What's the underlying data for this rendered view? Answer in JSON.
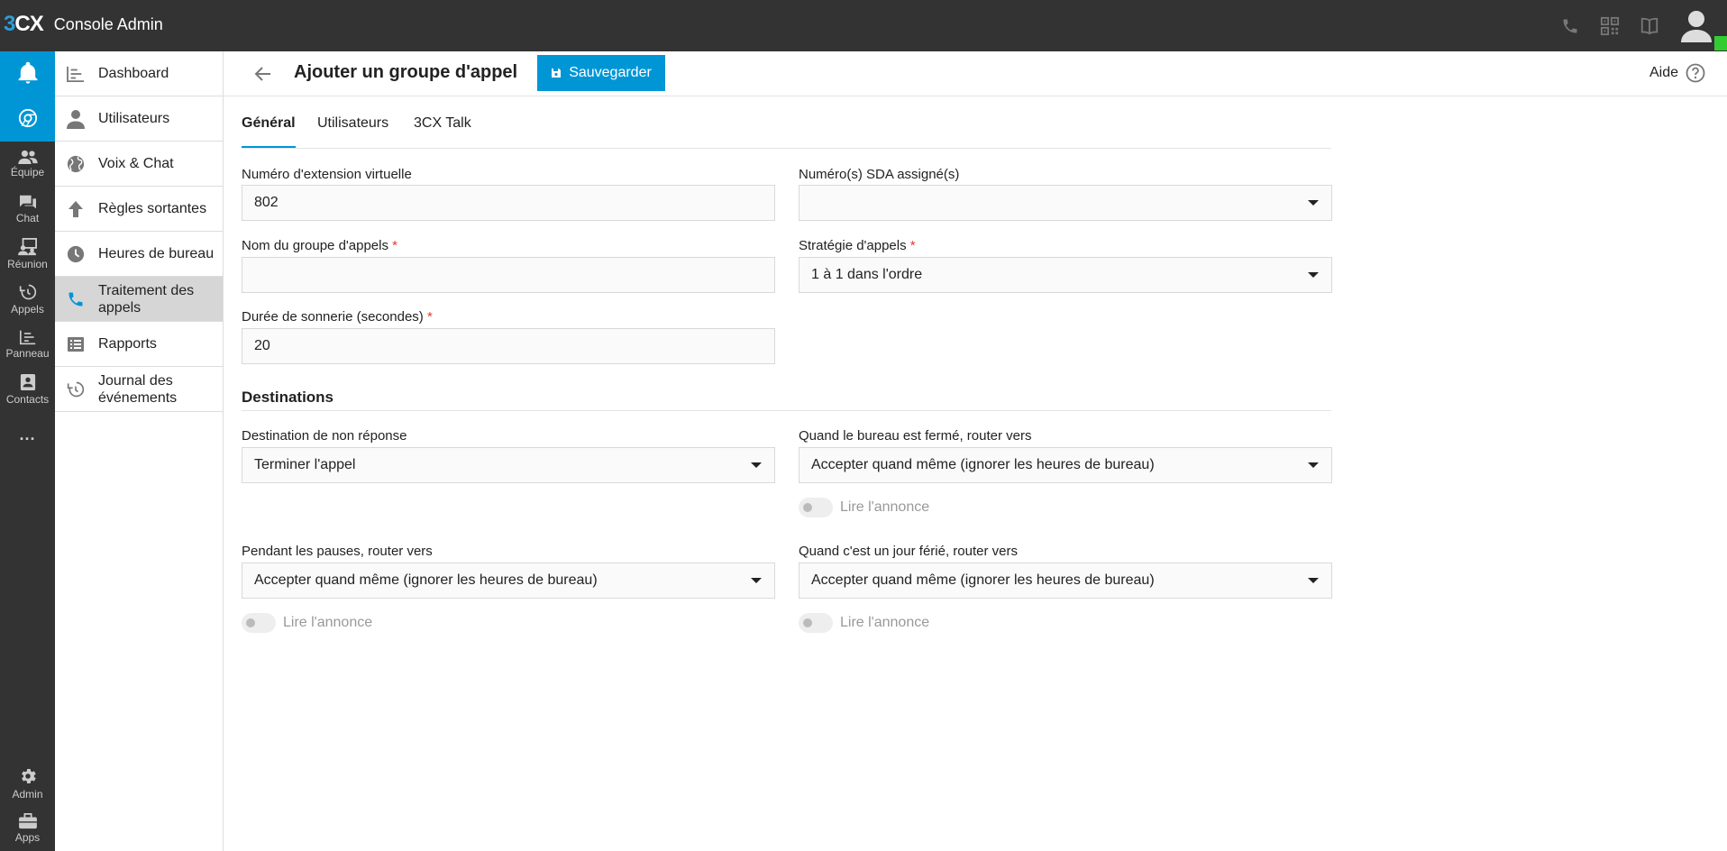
{
  "app": {
    "logo_three": "3",
    "logo_cx": "CX",
    "title": "Console Admin"
  },
  "topbar_icons": [
    "phone-icon",
    "qr-code-icon",
    "book-icon",
    "user-avatar-icon"
  ],
  "rail": {
    "items": [
      {
        "icon": "bell-icon",
        "label": ""
      },
      {
        "icon": "chrome-icon",
        "label": ""
      },
      {
        "icon": "team-icon",
        "label": "Équipe"
      },
      {
        "icon": "chat-icon",
        "label": "Chat"
      },
      {
        "icon": "meeting-icon",
        "label": "Réunion"
      },
      {
        "icon": "history-icon",
        "label": "Appels"
      },
      {
        "icon": "panel-icon",
        "label": "Panneau"
      },
      {
        "icon": "contacts-icon",
        "label": "Contacts"
      },
      {
        "icon": "more-icon",
        "label": "..."
      },
      {
        "icon": "gear-icon",
        "label": "Admin"
      },
      {
        "icon": "apps-icon",
        "label": "Apps"
      }
    ]
  },
  "nav": {
    "items": [
      {
        "label": "Dashboard",
        "icon": "dashboard-icon"
      },
      {
        "label": "Utilisateurs",
        "icon": "user-icon"
      },
      {
        "label": "Voix & Chat",
        "icon": "globe-icon"
      },
      {
        "label": "Règles sortantes",
        "icon": "arrow-up-icon"
      },
      {
        "label": "Heures de bureau",
        "icon": "clock-icon"
      },
      {
        "label": "Traitement des appels",
        "icon": "phone-icon"
      },
      {
        "label": "Rapports",
        "icon": "report-icon"
      },
      {
        "label": "Journal des événements",
        "icon": "history-icon"
      }
    ]
  },
  "header": {
    "title": "Ajouter un groupe d'appel",
    "save_label": "Sauvegarder",
    "help_label": "Aide"
  },
  "tabs": [
    {
      "label": "Général",
      "active": true
    },
    {
      "label": "Utilisateurs",
      "active": false
    },
    {
      "label": "3CX Talk",
      "active": false
    }
  ],
  "form": {
    "extension": {
      "label": "Numéro d'extension virtuelle",
      "value": "802"
    },
    "sda": {
      "label": "Numéro(s) SDA assigné(s)",
      "value": ""
    },
    "group_name": {
      "label": "Nom du groupe d'appels",
      "required": "*",
      "value": ""
    },
    "strategy": {
      "label": "Stratégie d'appels",
      "required": "*",
      "value": "1 à 1 dans l'ordre"
    },
    "ring_duration": {
      "label": "Durée de sonnerie (secondes)",
      "required": "*",
      "value": "20"
    }
  },
  "destinations": {
    "title": "Destinations",
    "no_answer": {
      "label": "Destination de non réponse",
      "value": "Terminer l'appel"
    },
    "office_closed": {
      "label": "Quand le bureau est fermé, router vers",
      "value": "Accepter quand même (ignorer les heures de bureau)",
      "toggle_label": "Lire l'annonce"
    },
    "breaks": {
      "label": "Pendant les pauses, router vers",
      "value": "Accepter quand même (ignorer les heures de bureau)",
      "toggle_label": "Lire l'annonce"
    },
    "holiday": {
      "label": "Quand c'est un jour férié, router vers",
      "value": "Accepter quand même (ignorer les heures de bureau)",
      "toggle_label": "Lire l'annonce"
    }
  },
  "colors": {
    "accent": "#0096d6",
    "topbar": "#333333",
    "required": "#e53935",
    "status": "#33cc33"
  }
}
